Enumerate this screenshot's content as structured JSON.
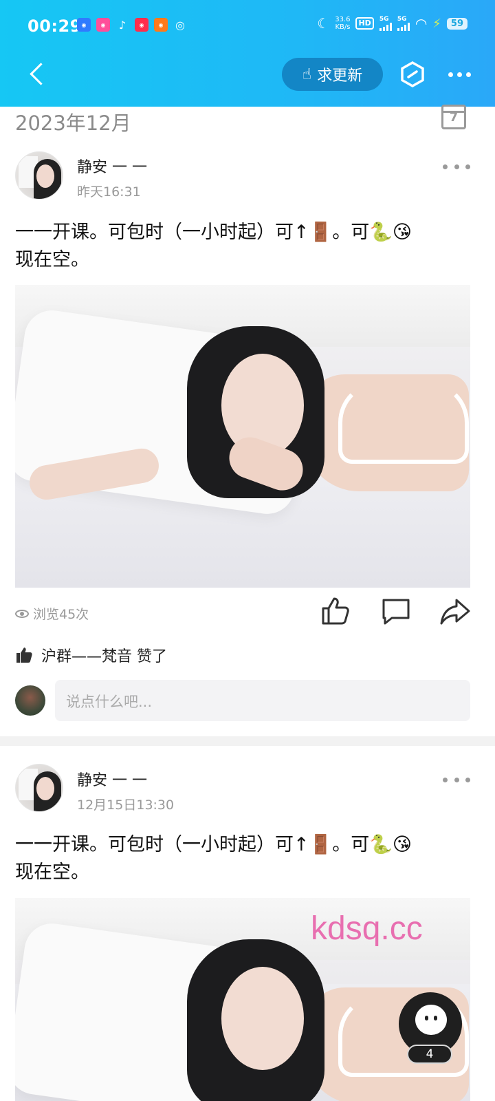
{
  "status_bar": {
    "time": "00:29",
    "net_speed_value": "33.6",
    "net_speed_unit": "KB/s",
    "hd": "HD",
    "sig1": "5G",
    "sig2": "5G",
    "battery": "59"
  },
  "header": {
    "update_label": "求更新",
    "accent_color": "#1386c6",
    "gradient_start": "#16c7f4"
  },
  "month_label": "2023年12月",
  "calendar_day": "7",
  "posts": [
    {
      "author": "静安 一 一",
      "time": "昨天16:31",
      "text_line1": "一一开课。可包时（一小时起）可↑🚪。可🐍😘",
      "text_line2": "现在空。",
      "views": "浏览45次",
      "liked_by": "沪群——梵音 赞了",
      "comment_placeholder": "说点什么吧..."
    },
    {
      "author": "静安 一 一",
      "time": "12月15日13:30",
      "text_line1": "一一开课。可包时（一小时起）可↑🚪。可🐍😘",
      "text_line2": "现在空。"
    }
  ],
  "watermark": "kdsq.cc",
  "float_badge_count": "4"
}
